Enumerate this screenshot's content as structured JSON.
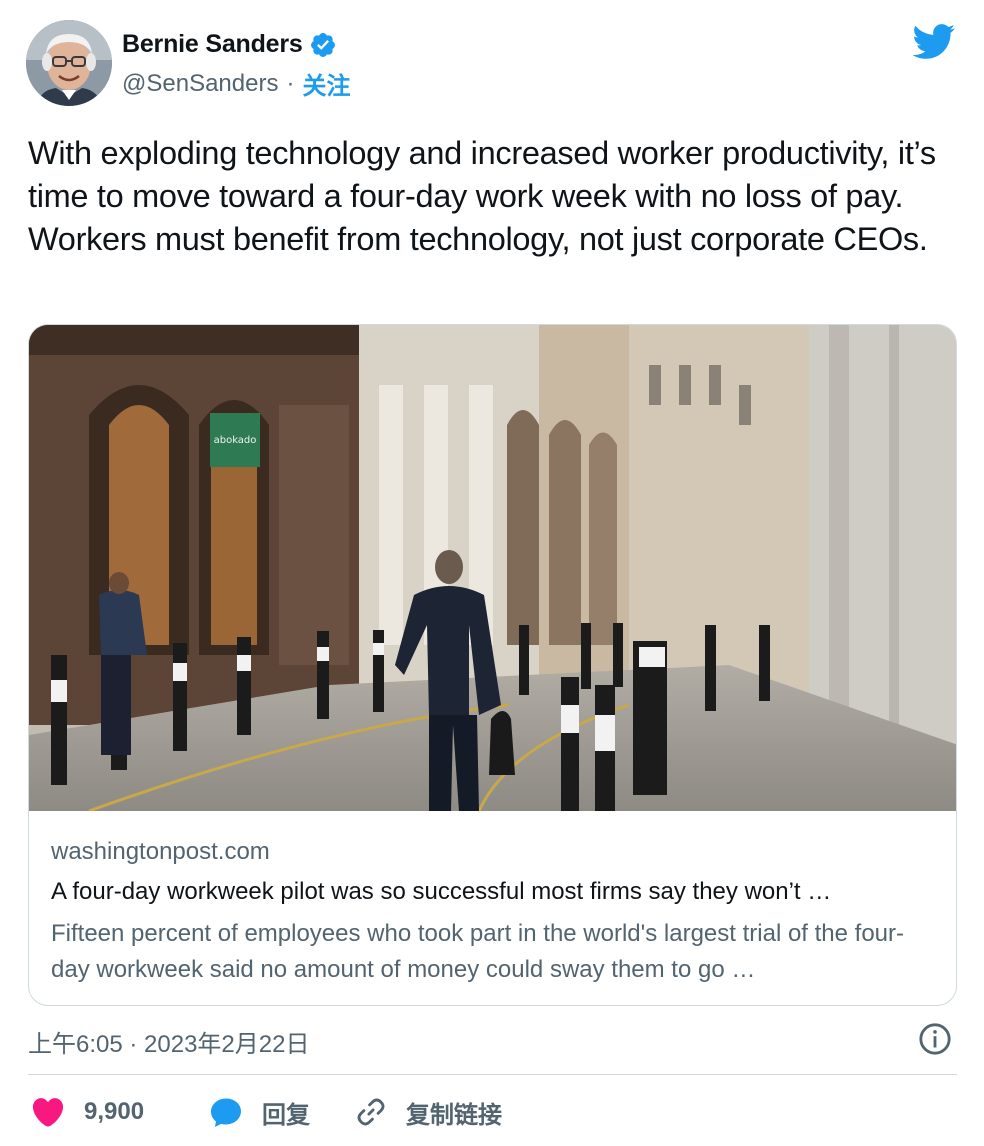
{
  "author": {
    "name": "Bernie Sanders",
    "handle": "@SenSanders",
    "separator": "·",
    "follow_label": "关注"
  },
  "tweet": {
    "text": "With exploding technology and increased worker productivity, it’s time to move toward a four-day work week with no loss of pay. Workers must benefit from technology, not just corporate CEOs."
  },
  "card": {
    "domain": "washingtonpost.com",
    "title": "A four-day workweek pilot was so successful most firms say they won’t …",
    "description": "Fifteen percent of employees who took part in the world's largest trial of the four-day workweek said no amount of money could sway them to go …",
    "image_sign_text": "abokado"
  },
  "meta": {
    "timestamp": "上午6:05 · 2023年2月22日"
  },
  "actions": {
    "like_count": "9,900",
    "reply_label": "回复",
    "copy_link_label": "复制链接"
  },
  "icons": {
    "verified": "verified-badge-icon",
    "brand": "twitter-bird-icon",
    "info": "info-icon",
    "like": "heart-icon",
    "reply": "speech-bubble-icon",
    "copy": "link-icon"
  },
  "colors": {
    "accent": "#1d9bf0",
    "like": "#f91880",
    "text": "#0f1419",
    "secondary": "#536471",
    "border": "#cfd9de"
  }
}
